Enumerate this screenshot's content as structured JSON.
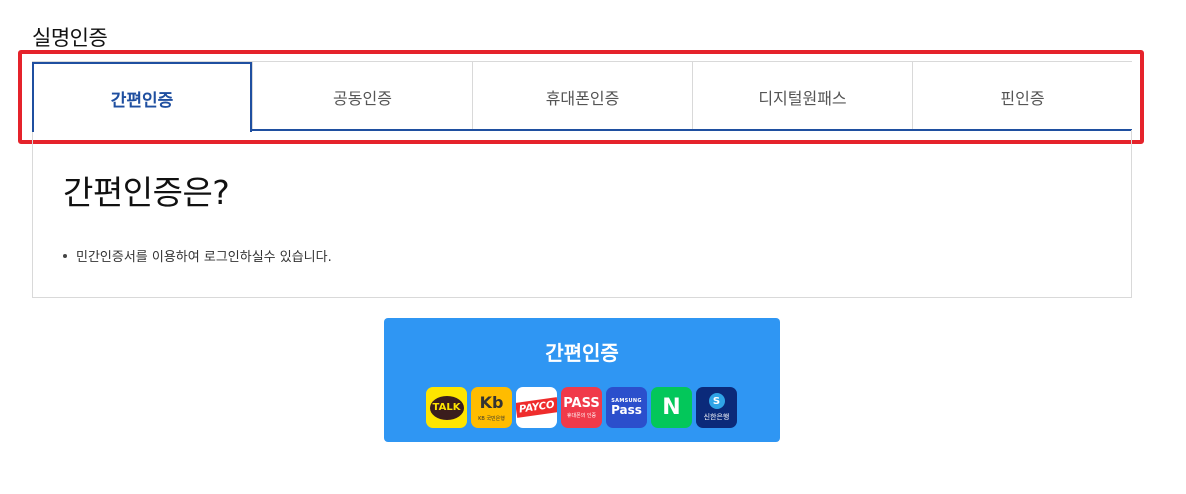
{
  "section": {
    "title": "실명인증"
  },
  "tabs": [
    {
      "label": "간편인증",
      "active": true
    },
    {
      "label": "공동인증",
      "active": false
    },
    {
      "label": "휴대폰인증",
      "active": false
    },
    {
      "label": "디지털원패스",
      "active": false
    },
    {
      "label": "핀인증",
      "active": false
    }
  ],
  "content": {
    "title": "간편인증은?",
    "description": "민간인증서를 이용하여 로그인하실수 있습니다."
  },
  "easy_auth_button": {
    "label": "간편인증",
    "logos": [
      {
        "name": "kakao-talk-logo",
        "text": "TALK",
        "color": "#fee500"
      },
      {
        "name": "kb-bank-logo",
        "mark": "Kb",
        "text": "KB 국민은행",
        "color": "#ffbc00"
      },
      {
        "name": "payco-logo",
        "text": "PAYCO",
        "color": "#ef2c2c"
      },
      {
        "name": "pass-logo",
        "text": "PASS",
        "sub": "휴대폰의 인증",
        "color": "#f03a4a"
      },
      {
        "name": "samsung-pass-logo",
        "top": "SAMSUNG",
        "text": "Pass",
        "color": "#2b4fcc"
      },
      {
        "name": "naver-logo",
        "text": "N",
        "color": "#03c75a"
      },
      {
        "name": "shinhan-bank-logo",
        "mark": "S",
        "text": "신한은행",
        "color": "#0b2a7a"
      }
    ]
  },
  "colors": {
    "accent": "#1f4fa0",
    "button": "#2f96f3",
    "highlight": "#e5232b"
  }
}
